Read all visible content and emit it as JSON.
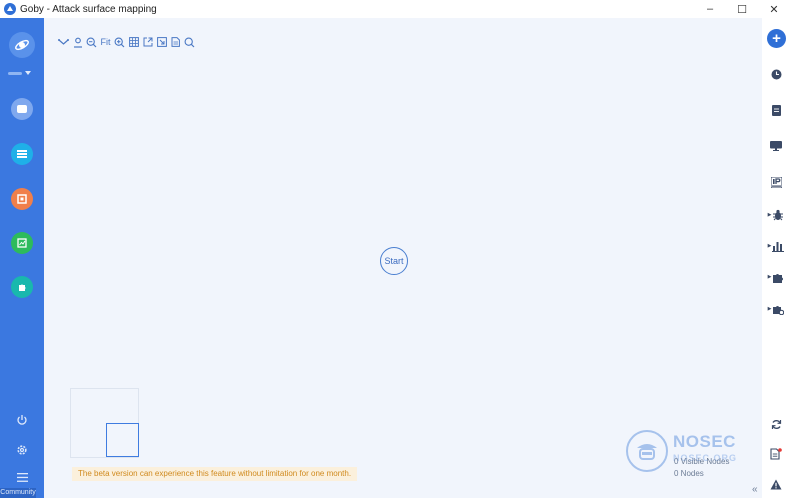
{
  "window": {
    "title": "Goby - Attack surface mapping",
    "controls": {
      "minimize": "–",
      "maximize": "☐",
      "close": "✕"
    }
  },
  "sidebar": {
    "edition": "Community",
    "nav_items": [
      {
        "name": "assets",
        "color": "#7fa8ee"
      },
      {
        "name": "list",
        "color": "#1fb0e8"
      },
      {
        "name": "report",
        "color": "#f07f4a"
      },
      {
        "name": "chart",
        "color": "#2dbb5c"
      },
      {
        "name": "plugin",
        "color": "#19b8ad"
      }
    ]
  },
  "toolbar": {
    "fit_label": "Fit"
  },
  "canvas": {
    "start_label": "Start",
    "beta_notice": "The beta version can experience this feature without limitation for one month.",
    "visible_nodes": "0 Visible Nodes",
    "total_nodes": "0 Nodes",
    "watermark_title": "NOSEC",
    "watermark_sub": "NOSEC.ORG"
  },
  "rightbar": {
    "add_label": "+",
    "collapse_label": "«"
  },
  "colors": {
    "brand_blue": "#3b78e0",
    "canvas_bg": "#f1f5fc",
    "notice_text": "#d08a1e"
  }
}
